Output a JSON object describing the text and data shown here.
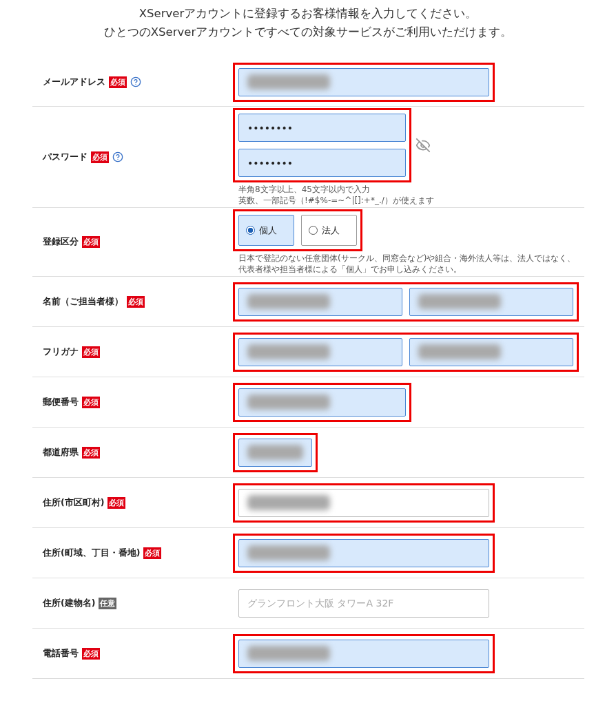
{
  "intro": [
    "XServerアカウントに登録するお客様情報を入力してください。",
    "ひとつのXServerアカウントですべての対象サービスがご利用いただけます。"
  ],
  "rows": [
    {
      "label": "メールアドレス",
      "badge": {
        "text": "必須",
        "kind": "required"
      },
      "help": true,
      "highlighted": true,
      "kind": "fields",
      "fields": [
        {
          "filled": true,
          "redacted": true
        }
      ]
    },
    {
      "label": "パスワード",
      "badge": {
        "text": "必須",
        "kind": "required"
      },
      "help": true,
      "highlighted": true,
      "kind": "password",
      "fields": [
        {
          "filled": true,
          "value": "••••••••"
        },
        {
          "filled": true,
          "value": "••••••••"
        }
      ],
      "notes": [
        "半角8文字以上、45文字以内で入力",
        "英数、一部記号（!#$%-=~^|[]:+*_./）が使えます"
      ]
    },
    {
      "label": "登録区分",
      "badge": {
        "text": "必須",
        "kind": "required"
      },
      "help": false,
      "highlighted": true,
      "kind": "radio",
      "options": [
        {
          "label": "個人",
          "selected": true
        },
        {
          "label": "法人",
          "selected": false
        }
      ],
      "notes": [
        "日本で登記のない任意団体(サークル、同窓会など)や組合・海外法人等は、法人ではなく、代表者様や担当者様による「個人」でお申し込みください。"
      ]
    },
    {
      "label": "名前（ご担当者様）",
      "badge": {
        "text": "必須",
        "kind": "required"
      },
      "help": false,
      "highlighted": true,
      "kind": "fields",
      "fields": [
        {
          "filled": true,
          "redacted": true
        },
        {
          "filled": true,
          "redacted": true
        }
      ]
    },
    {
      "label": "フリガナ",
      "badge": {
        "text": "必須",
        "kind": "required"
      },
      "help": false,
      "highlighted": true,
      "kind": "fields",
      "fields": [
        {
          "filled": true,
          "redacted": true
        },
        {
          "filled": true,
          "redacted": true
        }
      ]
    },
    {
      "label": "郵便番号",
      "badge": {
        "text": "必須",
        "kind": "required"
      },
      "help": false,
      "highlighted": true,
      "kind": "fields",
      "fields": [
        {
          "filled": true,
          "redacted": true
        }
      ]
    },
    {
      "label": "都道府県",
      "badge": {
        "text": "必須",
        "kind": "required"
      },
      "help": false,
      "highlighted": true,
      "kind": "fields",
      "fields": [
        {
          "filled": true,
          "redacted": true
        }
      ]
    },
    {
      "label": "住所(市区町村)",
      "badge": {
        "text": "必須",
        "kind": "required"
      },
      "help": false,
      "highlighted": true,
      "kind": "fields",
      "fields": [
        {
          "filled": false,
          "redacted": true
        }
      ]
    },
    {
      "label": "住所(町域、丁目・番地)",
      "badge": {
        "text": "必須",
        "kind": "required"
      },
      "help": false,
      "highlighted": true,
      "kind": "fields",
      "fields": [
        {
          "filled": true,
          "redacted": true
        }
      ]
    },
    {
      "label": "住所(建物名)",
      "badge": {
        "text": "任意",
        "kind": "optional"
      },
      "help": false,
      "highlighted": false,
      "kind": "fields",
      "fields": [
        {
          "filled": false,
          "placeholder": "グランフロント大阪 タワーA 32F"
        }
      ]
    },
    {
      "label": "電話番号",
      "badge": {
        "text": "必須",
        "kind": "required"
      },
      "help": false,
      "highlighted": true,
      "kind": "fields",
      "fields": [
        {
          "filled": true,
          "redacted": true
        }
      ]
    }
  ]
}
